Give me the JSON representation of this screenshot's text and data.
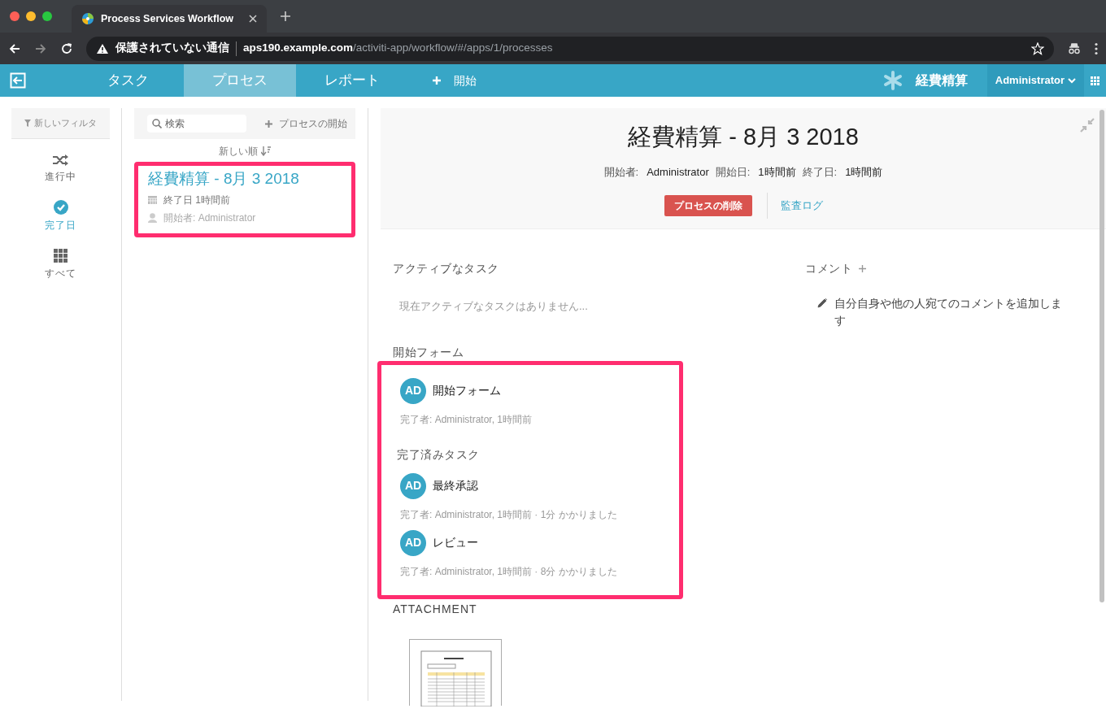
{
  "browser": {
    "tab_title": "Process Services Workflow",
    "security_warning": "保護されていない通信",
    "url_host": "aps190.example.com",
    "url_path": "/activiti-app/workflow/#/apps/1/processes"
  },
  "navbar": {
    "tabs": [
      {
        "label": "タスク",
        "selected": false
      },
      {
        "label": "プロセス",
        "selected": true
      },
      {
        "label": "レポート",
        "selected": false
      }
    ],
    "start_label": "開始",
    "app_name": "経費精算",
    "user": "Administrator"
  },
  "filters": {
    "new_filter": "新しいフィルタ",
    "items": [
      {
        "label": "進行中",
        "kind": "shuffle",
        "selected": false
      },
      {
        "label": "完了日",
        "kind": "check",
        "selected": true
      },
      {
        "label": "すべて",
        "kind": "grid",
        "selected": false
      }
    ]
  },
  "process_list": {
    "search_placeholder": "検索",
    "start_process": "プロセスの開始",
    "sort": "新しい順",
    "items": [
      {
        "title": "経費精算 - 8月 3 2018",
        "ended": "終了日 1時間前",
        "started_by": "開始者: Administrator",
        "highlighted": true
      }
    ]
  },
  "detail": {
    "title": "経費精算 - 8月 3 2018",
    "meta": [
      {
        "label": "開始者:",
        "value": "Administrator"
      },
      {
        "label": "開始日:",
        "value": "1時間前"
      },
      {
        "label": "終了日:",
        "value": "1時間前"
      }
    ],
    "delete_button": "プロセスの削除",
    "audit_log": "監査ログ",
    "active_tasks": {
      "heading": "アクティブなタスク",
      "empty": "現在アクティブなタスクはありません..."
    },
    "comments": {
      "heading": "コメント",
      "hint": "自分自身や他の人宛てのコメントを追加します"
    },
    "start_form_heading": "開始フォーム",
    "history": {
      "highlighted": true,
      "start_form": [
        {
          "initials": "AD",
          "name": "開始フォーム",
          "info": "完了者: Administrator, 1時間前"
        }
      ],
      "completed_heading": "完了済みタスク",
      "completed": [
        {
          "initials": "AD",
          "name": "最終承認",
          "info": "完了者: Administrator, 1時間前 · 1分 かかりました"
        },
        {
          "initials": "AD",
          "name": "レビュー",
          "info": "完了者: Administrator, 1時間前 · 8分 かかりました"
        }
      ]
    },
    "attachment_heading": "ATTACHMENT"
  }
}
